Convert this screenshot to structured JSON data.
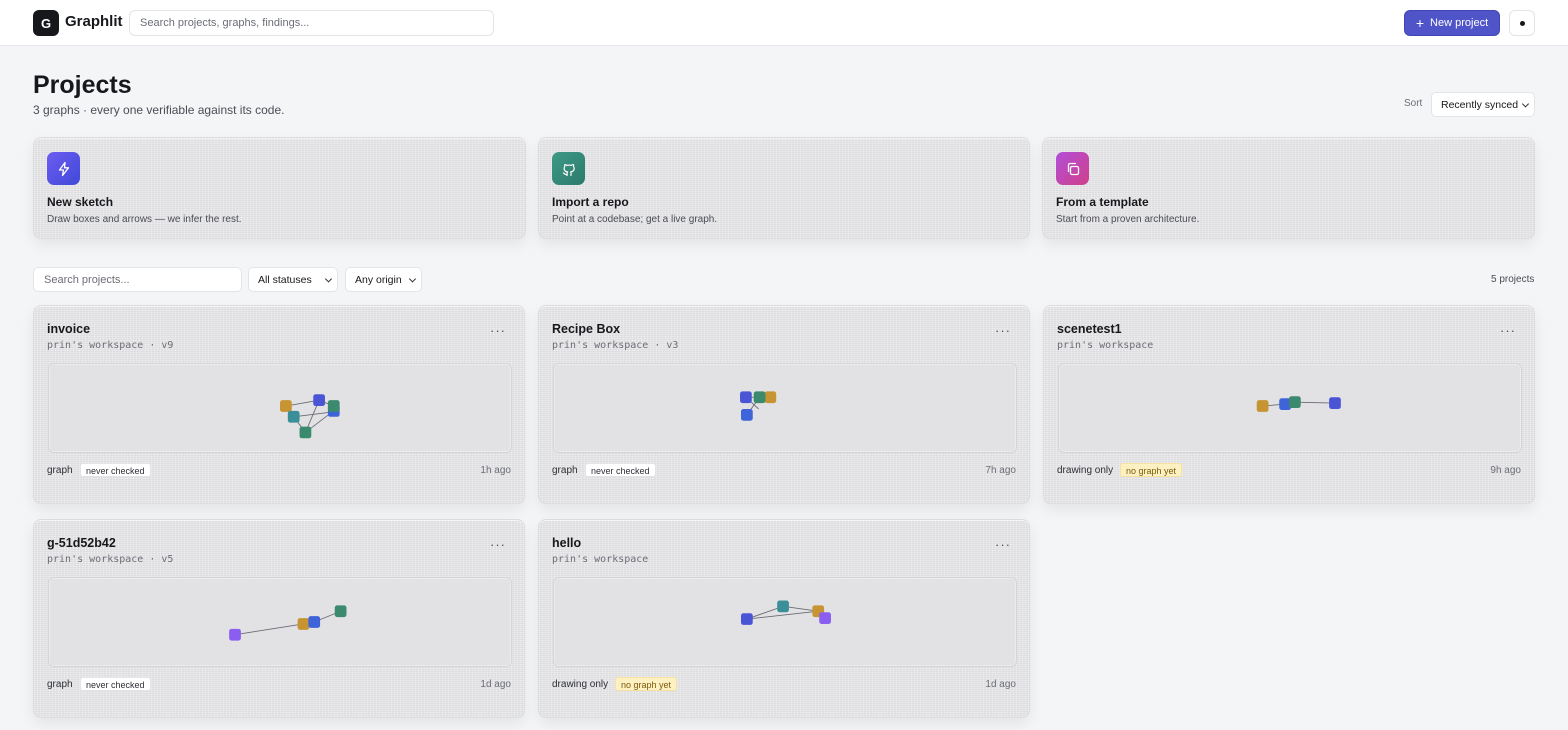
{
  "app": {
    "logo_letter": "G",
    "name": "Graphlit"
  },
  "header": {
    "search_placeholder": "Search projects, graphs, findings...",
    "new_project_label": "New project"
  },
  "page": {
    "title": "Projects",
    "subtitle": "3 graphs · every one verifiable against its code.",
    "sort_label": "Sort",
    "sort_value": "Recently synced"
  },
  "quickstart": [
    {
      "title": "New sketch",
      "desc": "Draw boxes and arrows — we infer the rest.",
      "icon": "lightning-icon",
      "color_from": "#6d5cf0",
      "color_to": "#3f49d8"
    },
    {
      "title": "Import a repo",
      "desc": "Point at a codebase; get a live graph.",
      "icon": "github-icon",
      "color_from": "#3f9a86",
      "color_to": "#2b7a6c"
    },
    {
      "title": "From a template",
      "desc": "Start from a proven architecture.",
      "icon": "copy-icon",
      "color_from": "#b24ed8",
      "color_to": "#d0408a"
    }
  ],
  "filters": {
    "search_placeholder": "Search projects...",
    "status_value": "All statuses",
    "origin_value": "Any origin",
    "count_label": "5 projects"
  },
  "projects": [
    {
      "name": "invoice",
      "subtitle": "prin's workspace · v9",
      "kind": "graph",
      "badge": "never checked",
      "badge_type": "never",
      "time": "1h ago"
    },
    {
      "name": "Recipe Box",
      "subtitle": "prin's workspace · v3",
      "kind": "graph",
      "badge": "never checked",
      "badge_type": "never",
      "time": "7h ago"
    },
    {
      "name": "scenetest1",
      "subtitle": "prin's workspace",
      "kind": "drawing only",
      "badge": "no graph yet",
      "badge_type": "nograph",
      "time": "9h ago"
    },
    {
      "name": "g-51d52b42",
      "subtitle": "prin's workspace · v5",
      "kind": "graph",
      "badge": "never checked",
      "badge_type": "never",
      "time": "1d ago"
    },
    {
      "name": "hello",
      "subtitle": "prin's workspace",
      "kind": "drawing only",
      "badge": "no graph yet",
      "badge_type": "nograph",
      "time": "1d ago"
    }
  ],
  "colors": {
    "accent": "#4f55c9",
    "node_orange": "#c79433",
    "node_blue": "#4a55d6",
    "node_teal": "#3a8f98",
    "node_green": "#3b8a6e",
    "node_purple": "#8a5ef0",
    "node_royal": "#3f63d8"
  }
}
